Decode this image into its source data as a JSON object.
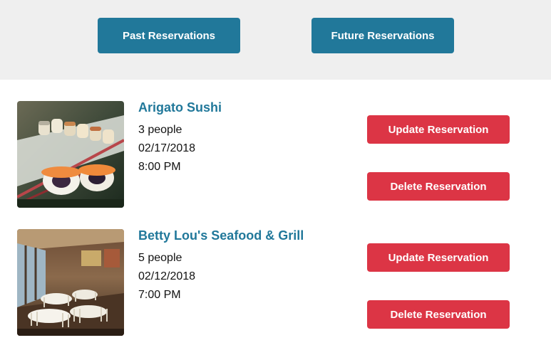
{
  "tabs": {
    "past_label": "Past Reservations",
    "future_label": "Future Reservations"
  },
  "reservations": [
    {
      "name": "Arigato Sushi",
      "party": "3 people",
      "date": "02/17/2018",
      "time": "8:00 PM",
      "image": "sushi-photo",
      "update_label": "Update Reservation",
      "delete_label": "Delete Reservation"
    },
    {
      "name": "Betty Lou's Seafood & Grill",
      "party": "5 people",
      "date": "02/12/2018",
      "time": "7:00 PM",
      "image": "restaurant-interior-photo",
      "update_label": "Update Reservation",
      "delete_label": "Delete Reservation"
    }
  ],
  "colors": {
    "primary": "#21789a",
    "danger": "#dc3545",
    "header_bg": "#efefef"
  }
}
